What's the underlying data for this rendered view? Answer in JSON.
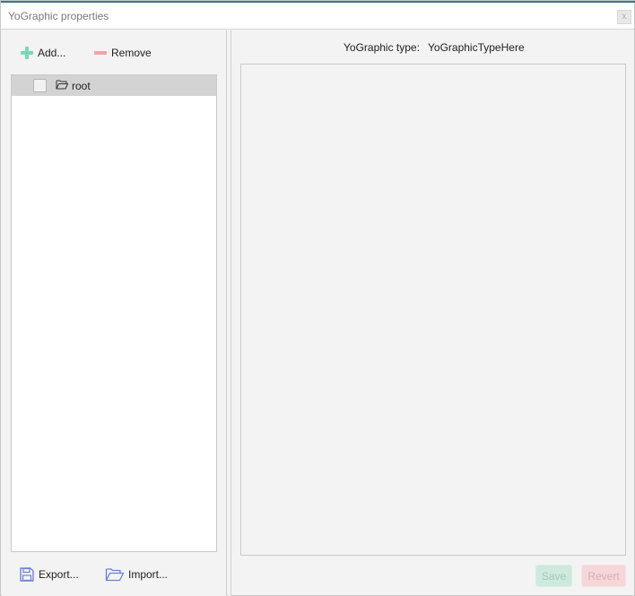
{
  "window": {
    "title": "YoGraphic properties",
    "close_glyph": "x",
    "accent_color": "#2f7d86"
  },
  "toolbar": {
    "add_label": "Add...",
    "remove_label": "Remove",
    "add_icon": "plus-icon",
    "remove_icon": "minus-icon",
    "add_color": "#7ad7b3",
    "remove_color": "#f2a3a9"
  },
  "tree": {
    "items": [
      {
        "label": "root",
        "checked": false,
        "selected": true,
        "icon": "folder-open-icon"
      }
    ]
  },
  "details": {
    "type_label": "YoGraphic type:",
    "type_value": "YoGraphicTypeHere"
  },
  "footer": {
    "export_label": "Export...",
    "import_label": "Import...",
    "export_icon": "floppy-disk-icon",
    "import_icon": "folder-open-icon"
  },
  "actions": {
    "save_label": "Save",
    "revert_label": "Revert",
    "save_color": "#cdeadc",
    "revert_color": "#f6d6d9"
  }
}
